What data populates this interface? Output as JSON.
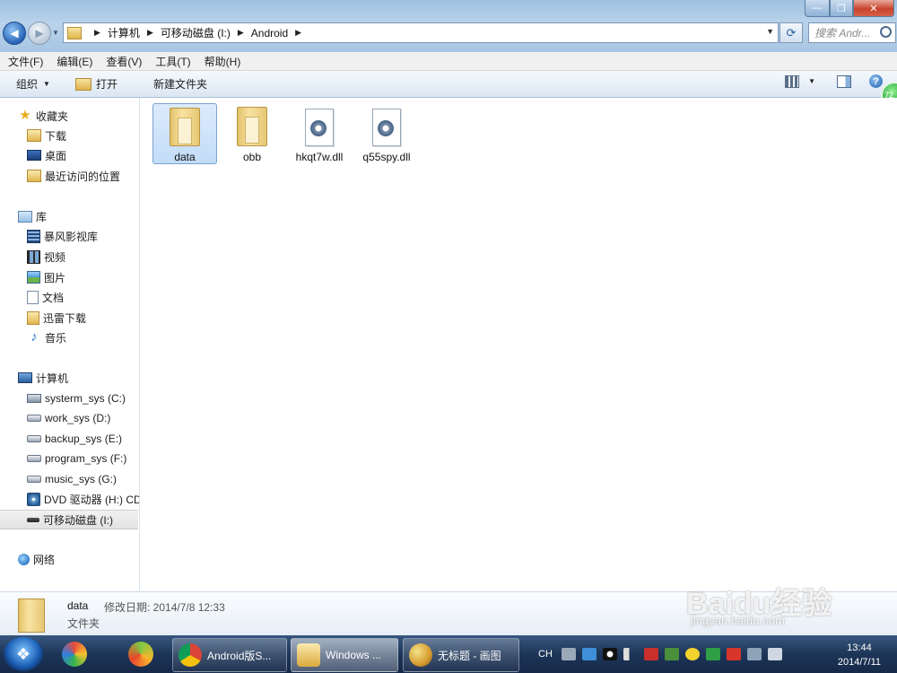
{
  "address": {
    "crumbs": [
      "计算机",
      "可移动磁盘 (I:)",
      "Android"
    ],
    "search_placeholder": "搜索 Andr..."
  },
  "menu": [
    "文件(F)",
    "编辑(E)",
    "查看(V)",
    "工具(T)",
    "帮助(H)"
  ],
  "toolbar": {
    "organize": "组织",
    "open": "打开",
    "new_folder": "新建文件夹"
  },
  "speedball_text": "72",
  "nav": {
    "favorites": {
      "label": "收藏夹",
      "items": [
        "下载",
        "桌面",
        "最近访问的位置"
      ]
    },
    "libraries": {
      "label": "库",
      "items": [
        "暴风影视库",
        "视频",
        "图片",
        "文档",
        "迅雷下载",
        "音乐"
      ]
    },
    "computer": {
      "label": "计算机",
      "items": [
        "systerm_sys (C:)",
        "work_sys (D:)",
        "backup_sys (E:)",
        "program_sys (F:)",
        "music_sys (G:)",
        "DVD 驱动器 (H:) CD",
        "可移动磁盘 (I:)"
      ]
    },
    "network": {
      "label": "网络"
    }
  },
  "files": [
    {
      "name": "data",
      "type": "folder"
    },
    {
      "name": "obb",
      "type": "folder"
    },
    {
      "name": "hkqt7w.dll",
      "type": "dll"
    },
    {
      "name": "q55spy.dll",
      "type": "dll"
    }
  ],
  "details": {
    "name": "data",
    "modified": "修改日期: 2014/7/8 12:33",
    "type": "文件夹"
  },
  "taskbar": {
    "buttons": [
      "Android版S...",
      "Windows ...",
      "无标题 - 画图"
    ],
    "ime": "CH",
    "time": "13:44",
    "date": "2014/7/11"
  },
  "watermark": {
    "logo": "Baidu经验",
    "url": "jingyan.baidu.com"
  }
}
